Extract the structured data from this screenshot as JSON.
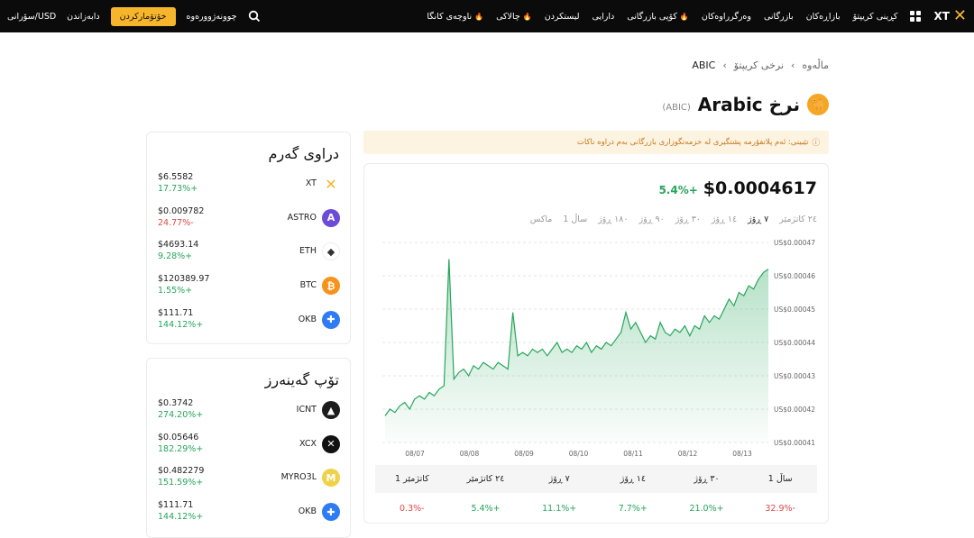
{
  "nav": {
    "logo": "XT",
    "items": [
      {
        "label": "کڕینی کریپتۆ",
        "hot": false
      },
      {
        "label": "بازاڕەکان",
        "hot": false
      },
      {
        "label": "بازرگانی",
        "hot": false
      },
      {
        "label": "وەرگرراوەکان",
        "hot": false
      },
      {
        "label": "کۆپی بازرگانی",
        "hot": true
      },
      {
        "label": "دارایی",
        "hot": false
      },
      {
        "label": "لیستکردن",
        "hot": false
      },
      {
        "label": "چالاکی",
        "hot": true
      },
      {
        "label": "ناوچەی کانگا",
        "hot": true
      }
    ],
    "left": {
      "language": "سۆرانی/USD",
      "download": "دابەزاندن",
      "register": "خۆتۆمارکردن",
      "login": "چوونەژوورەوە"
    }
  },
  "breadcrumb": {
    "home": "ماڵەوە",
    "section": "نرخی کریپتۆ",
    "current": "ABIC"
  },
  "coin": {
    "title": "Arabic نرخ",
    "ticker": "(ABIC)"
  },
  "notice": "تێبینی: ئەم پلاتفۆرمە پشتگیری لە خزمەتگوزاری بازرگانی بەم دراوە ناکات",
  "price": {
    "value": "$0.0004617",
    "change": "5.4%+"
  },
  "ranges": [
    "٢٤ کاتژمێر",
    "٧ ڕۆژ",
    "١٤ ڕۆژ",
    "٣٠ ڕۆژ",
    "٩٠ ڕۆژ",
    "١٨٠ ڕۆژ",
    "1 ساڵ",
    "ماکس"
  ],
  "active_range": 1,
  "chart_data": {
    "type": "area",
    "ylabels": [
      "US$0.00047",
      "US$0.00046",
      "US$0.00045",
      "US$0.00044",
      "US$0.00043",
      "US$0.00042",
      "US$0.00041"
    ],
    "xlabels": [
      "08/07",
      "08/08",
      "08/09",
      "08/10",
      "08/11",
      "08/12",
      "08/13"
    ],
    "ylim": [
      0.00041,
      0.00047
    ],
    "color": "#26a65b",
    "values": [
      0.000418,
      0.00042,
      0.000419,
      0.000421,
      0.000422,
      0.00042,
      0.000423,
      0.000424,
      0.000423,
      0.000425,
      0.000424,
      0.000426,
      0.000427,
      0.000465,
      0.000429,
      0.000431,
      0.000432,
      0.00043,
      0.000433,
      0.000432,
      0.000434,
      0.000433,
      0.000432,
      0.000434,
      0.000433,
      0.000432,
      0.000449,
      0.000436,
      0.000437,
      0.000436,
      0.000438,
      0.000437,
      0.000438,
      0.000436,
      0.000438,
      0.00044,
      0.000437,
      0.000438,
      0.000437,
      0.000439,
      0.000438,
      0.00044,
      0.000437,
      0.000439,
      0.000438,
      0.00044,
      0.000439,
      0.000441,
      0.000443,
      0.000449,
      0.000444,
      0.000446,
      0.000443,
      0.00044,
      0.000442,
      0.000441,
      0.000446,
      0.000443,
      0.000442,
      0.000444,
      0.000443,
      0.000445,
      0.000442,
      0.000445,
      0.000444,
      0.000448,
      0.000446,
      0.000448,
      0.000447,
      0.00045,
      0.000453,
      0.000451,
      0.000455,
      0.000454,
      0.000457,
      0.000456,
      0.000459,
      0.000461,
      0.000462
    ]
  },
  "perf_table": {
    "headers": [
      "1 کاتژمێر",
      "٢٤ کاتژمێر",
      "٧ ڕۆژ",
      "١٤ ڕۆژ",
      "٣٠ ڕۆژ",
      "1 ساڵ"
    ],
    "values": [
      {
        "v": "0.3%-",
        "up": false
      },
      {
        "v": "5.4%+",
        "up": true
      },
      {
        "v": "11.1%+",
        "up": true
      },
      {
        "v": "7.7%+",
        "up": true
      },
      {
        "v": "21.0%+",
        "up": true
      },
      {
        "v": "32.9%-",
        "up": false
      }
    ]
  },
  "hot": {
    "title": "دراوی گەرم",
    "items": [
      {
        "symbol": "XT",
        "price": "$6.5582",
        "change": "17.73%+",
        "up": true,
        "color": "#f7b52c",
        "icon": "xt-icon",
        "glyph": "✕"
      },
      {
        "symbol": "ASTRO",
        "price": "$0.009782",
        "change": "24.77%-",
        "up": false,
        "color": "#6b4bd8",
        "icon": "astro-icon",
        "glyph": "A"
      },
      {
        "symbol": "ETH",
        "price": "$4693.14",
        "change": "9.28%+",
        "up": true,
        "color": "#ffffff",
        "icon": "eth-icon",
        "glyph": "◆"
      },
      {
        "symbol": "BTC",
        "price": "$120389.97",
        "change": "1.55%+",
        "up": true,
        "color": "#f7931a",
        "icon": "btc-icon",
        "glyph": "₿"
      },
      {
        "symbol": "OKB",
        "price": "$111.71",
        "change": "144.12%+",
        "up": true,
        "color": "#2f7bf5",
        "icon": "okb-icon",
        "glyph": "✚"
      }
    ]
  },
  "gainers": {
    "title": "تۆپ گەینەرز",
    "items": [
      {
        "symbol": "ICNT",
        "price": "$0.3742",
        "change": "274.20%+",
        "up": true,
        "color": "#1c1c1c",
        "icon": "icnt-icon",
        "glyph": "▲"
      },
      {
        "symbol": "XCX",
        "price": "$0.05646",
        "change": "182.29%+",
        "up": true,
        "color": "#111111",
        "icon": "xcx-icon",
        "glyph": "✕"
      },
      {
        "symbol": "MYRO3L",
        "price": "$0.482279",
        "change": "151.59%+",
        "up": true,
        "color": "#f0d24a",
        "icon": "myro-icon",
        "glyph": "M"
      },
      {
        "symbol": "OKB",
        "price": "$111.71",
        "change": "144.12%+",
        "up": true,
        "color": "#2f7bf5",
        "icon": "okb-icon",
        "glyph": "✚"
      }
    ]
  }
}
